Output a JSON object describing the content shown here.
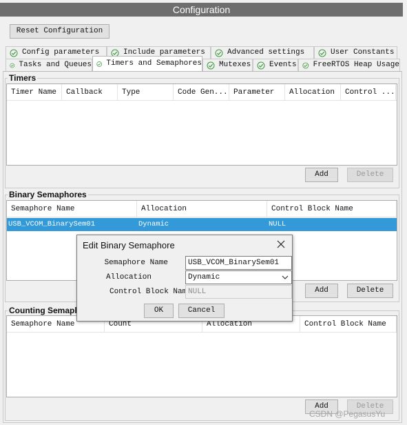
{
  "window": {
    "title": "Configuration"
  },
  "toolbar": {
    "reset_label": "Reset Configuration"
  },
  "tabs_row1": [
    {
      "label": "Config parameters"
    },
    {
      "label": "Include parameters"
    },
    {
      "label": "Advanced settings"
    },
    {
      "label": "User Constants"
    }
  ],
  "tabs_row2": [
    {
      "label": "Tasks and Queues"
    },
    {
      "label": "Timers and Semaphores"
    },
    {
      "label": "Mutexes"
    },
    {
      "label": "Events"
    },
    {
      "label": "FreeRTOS Heap Usage"
    }
  ],
  "timers": {
    "title": "Timers",
    "columns": [
      "Timer Name",
      "Callback",
      "Type",
      "Code Gen...",
      "Parameter",
      "Allocation",
      "Control ..."
    ],
    "add_label": "Add",
    "delete_label": "Delete"
  },
  "binary": {
    "title": "Binary Semaphores",
    "columns": [
      "Semaphore Name",
      "Allocation",
      "Control Block Name"
    ],
    "rows": [
      {
        "name": "USB_VCOM_BinarySem01",
        "allocation": "Dynamic",
        "control": "NULL"
      }
    ],
    "add_label": "Add",
    "delete_label": "Delete"
  },
  "counting": {
    "title": "Counting Semaphores",
    "columns": [
      "Semaphore Name",
      "Count",
      "Allocation",
      "Control Block Name"
    ],
    "add_label": "Add",
    "delete_label": "Delete"
  },
  "dialog": {
    "title": "Edit Binary Semaphore",
    "name_label": "Semaphore Name",
    "name_value": "USB_VCOM_BinarySem01",
    "alloc_label": "Allocation",
    "alloc_value": "Dynamic",
    "cb_label": "Control Block Name",
    "cb_value": "NULL",
    "ok_label": "OK",
    "cancel_label": "Cancel"
  },
  "watermark": "CSDN @PegasusYu",
  "icons": {
    "tab_status": "check-circle-icon",
    "dialog_close": "close-icon",
    "dropdown": "chevron-down-icon"
  },
  "colors": {
    "selection": "#3399d8",
    "title_bar": "#6e6e6e",
    "check": "#3c9a3c"
  }
}
